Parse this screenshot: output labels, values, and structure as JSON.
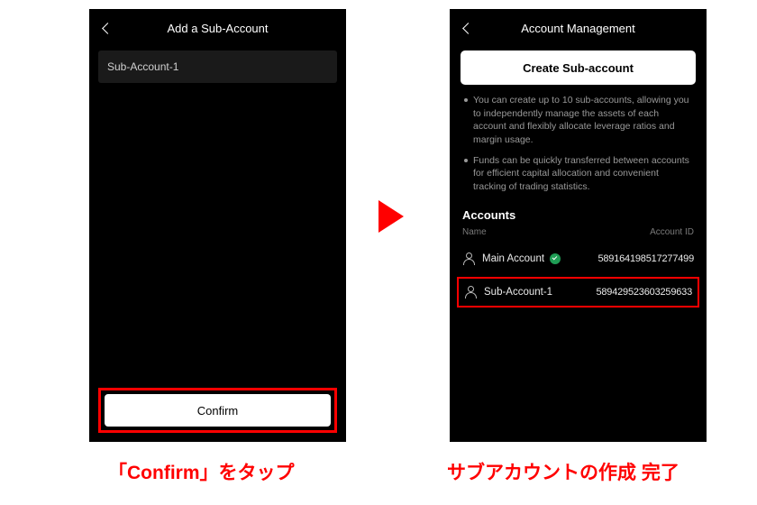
{
  "left": {
    "title": "Add a Sub-Account",
    "input_value": "Sub-Account-1",
    "confirm_label": "Confirm"
  },
  "right": {
    "title": "Account Management",
    "create_label": "Create Sub-account",
    "bullet1": "You can create up to 10 sub-accounts, allowing you to independently manage the assets of each account and flexibly allocate leverage ratios and margin usage.",
    "bullet2": "Funds can be quickly transferred between accounts for efficient capital allocation and convenient tracking of trading statistics.",
    "accounts_header": "Accounts",
    "col_name": "Name",
    "col_id": "Account ID",
    "rows": [
      {
        "name": "Main Account",
        "id": "589164198517277499",
        "verified": true
      },
      {
        "name": "Sub-Account-1",
        "id": "589429523603259633",
        "verified": false
      }
    ]
  },
  "captions": {
    "left": "「Confirm」をタップ",
    "right": "サブアカウントの作成 完了"
  }
}
